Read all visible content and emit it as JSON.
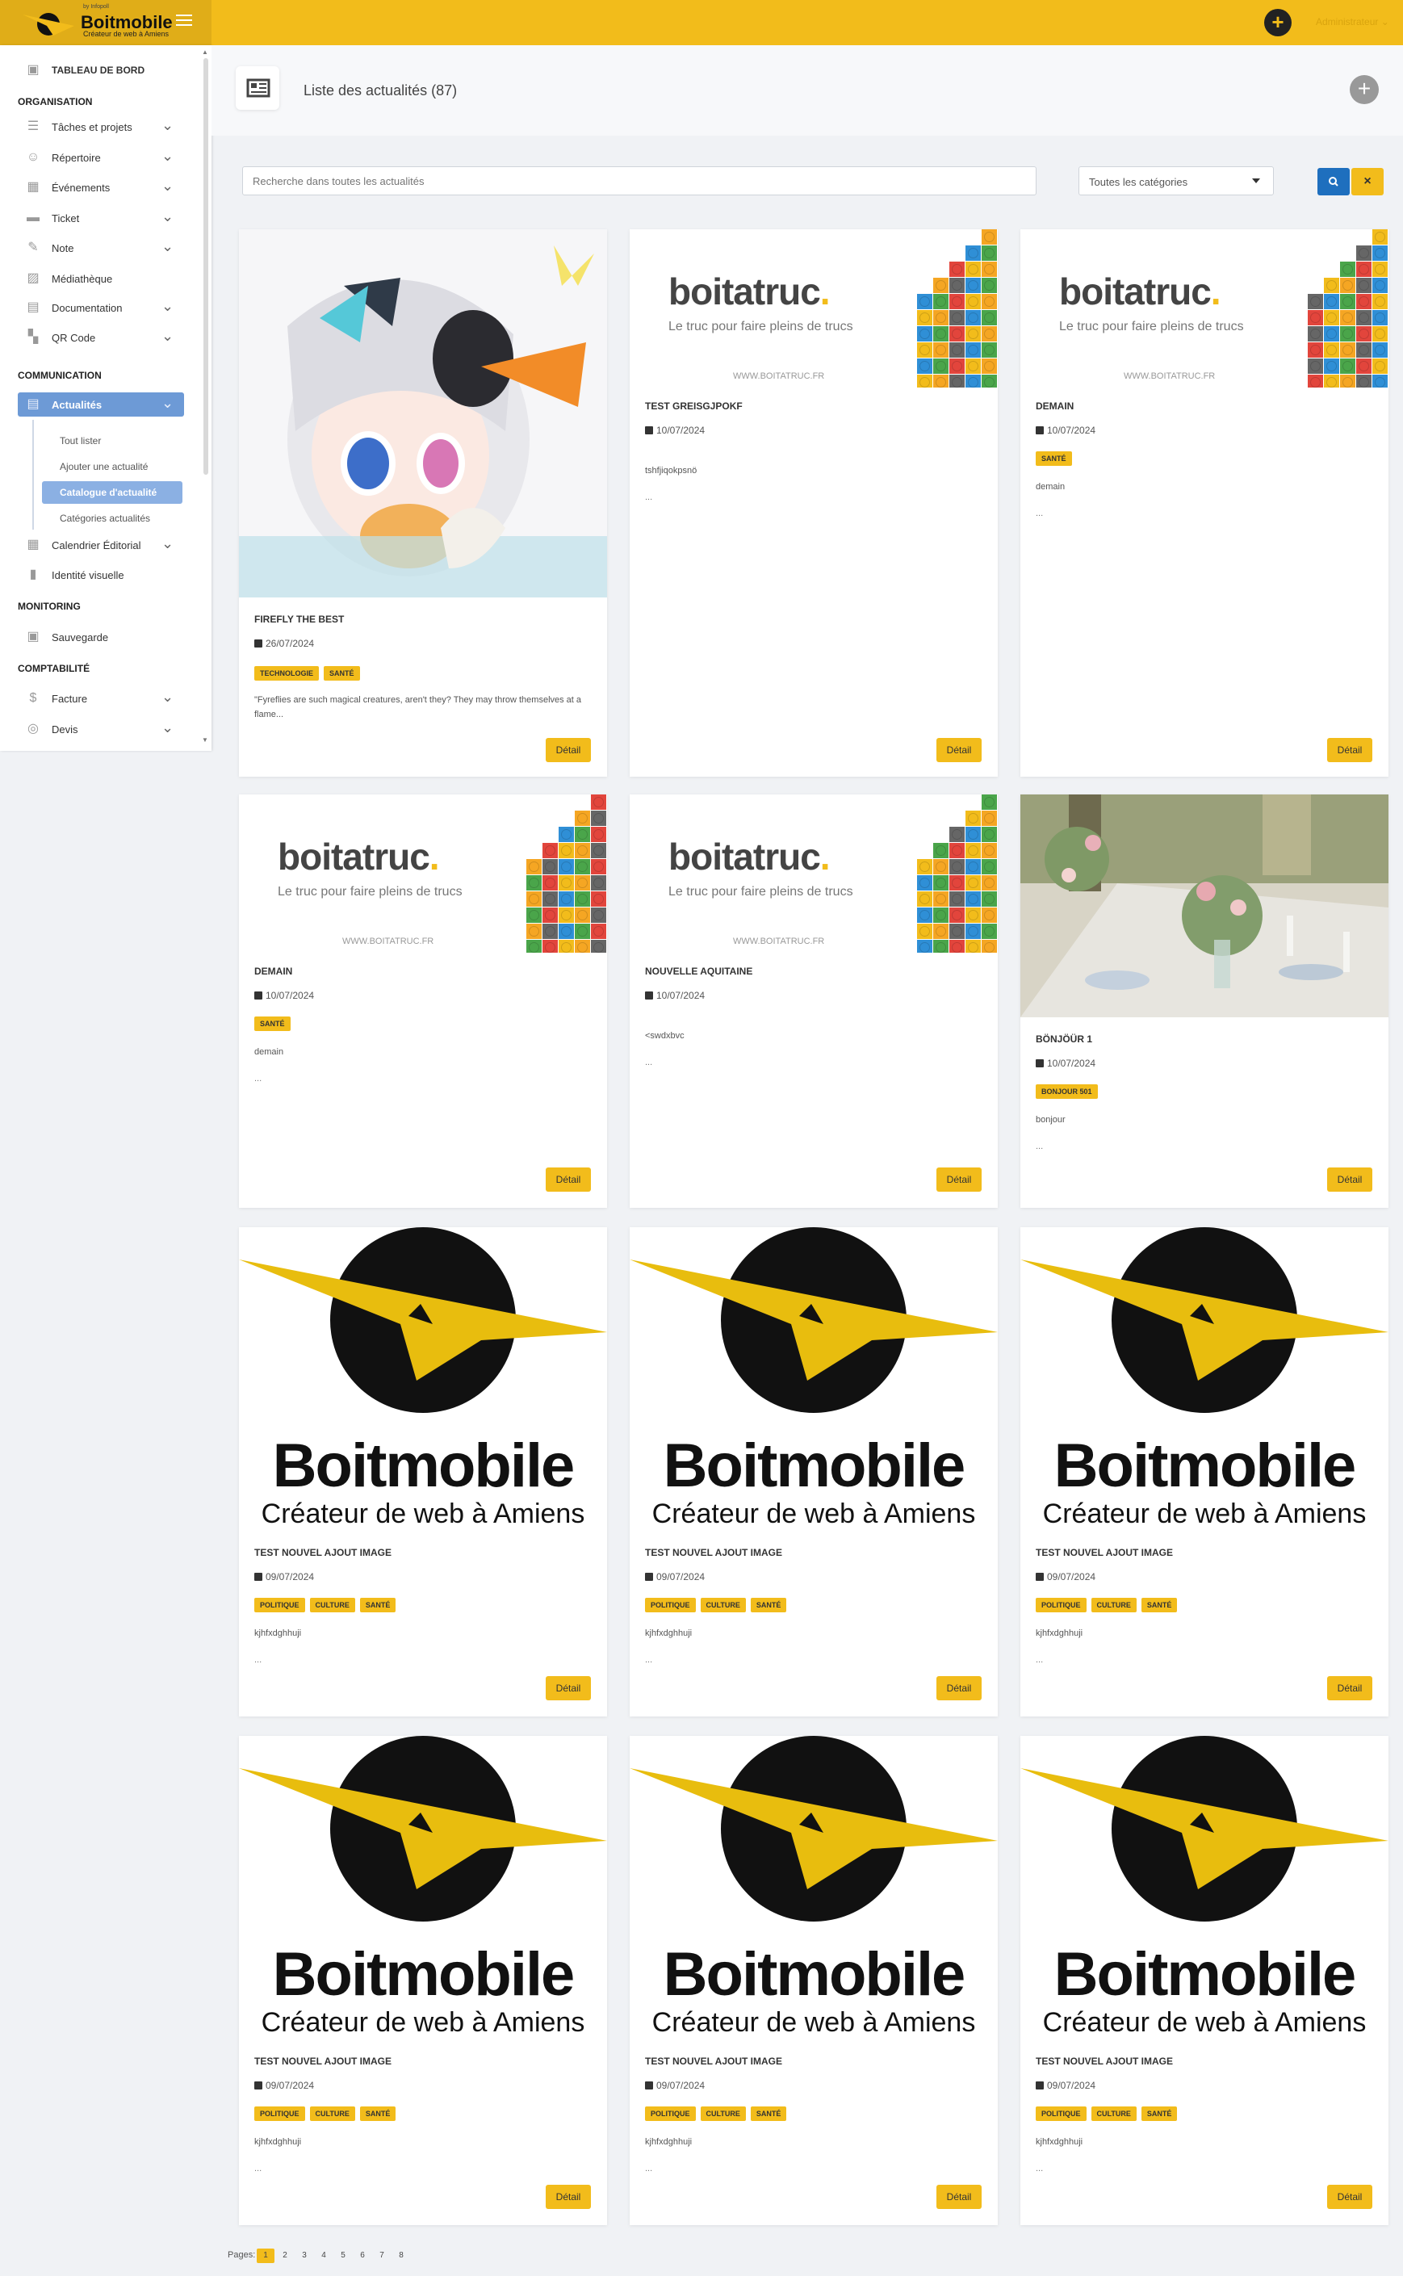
{
  "app": {
    "brand_name": "Boitmobile",
    "brand_tagline": "Créateur de web à Amiens",
    "brand_overline": "by Infopoll",
    "user_label": "Administrateur"
  },
  "sidebar": {
    "dashboard": "TABLEAU DE BORD",
    "sections": {
      "organisation": "ORGANISATION",
      "communication": "COMMUNICATION",
      "monitoring": "MONITORING",
      "comptabilite": "COMPTABILITÉ"
    },
    "items": {
      "taches": "Tâches et projets",
      "repertoire": "Répertoire",
      "evenements": "Événements",
      "ticket": "Ticket",
      "note": "Note",
      "mediatheque": "Médiathèque",
      "documentation": "Documentation",
      "qrcode": "QR Code",
      "actualites": "Actualités",
      "calendrier": "Calendrier Éditorial",
      "identite": "Identité visuelle",
      "sauvegarde": "Sauvegarde",
      "facture": "Facture",
      "devis": "Devis"
    },
    "subitems": {
      "tout_lister": "Tout lister",
      "ajouter": "Ajouter une actualité",
      "catalogue": "Catalogue d'actualité",
      "categories": "Catégories actualités"
    }
  },
  "page": {
    "title": "Liste des actualités (87)"
  },
  "filters": {
    "search_placeholder": "Recherche dans toutes les actualités",
    "category_selected": "Toutes les catégories",
    "clear_label": "×"
  },
  "detail_label": "Détail",
  "boitatruc": {
    "name": "boitatruc",
    "dot": ".",
    "tagline": "Le truc pour faire pleins de trucs",
    "url": "WWW.BOITATRUC.FR"
  },
  "cards": [
    {
      "title": "FIREFLY THE BEST",
      "date": "26/07/2024",
      "tags": [
        "TECHNOLOGIE",
        "SANTÉ"
      ],
      "excerpt": "\"Fyreflies are such magical creatures, aren't they? They may throw themselves at a flame...",
      "dots": ""
    },
    {
      "title": "TEST GREISGJPOKF",
      "date": "10/07/2024",
      "tags": [],
      "excerpt": "tshfjiqokpsnö",
      "dots": "..."
    },
    {
      "title": "DEMAIN",
      "date": "10/07/2024",
      "tags": [
        "SANTÉ"
      ],
      "excerpt": "demain",
      "dots": "..."
    },
    {
      "title": "DEMAIN",
      "date": "10/07/2024",
      "tags": [
        "SANTÉ"
      ],
      "excerpt": "demain",
      "dots": "..."
    },
    {
      "title": "NOUVELLE AQUITAINE",
      "date": "10/07/2024",
      "tags": [],
      "excerpt": "<swdxbvc",
      "dots": "..."
    },
    {
      "title": "BÖNJÖÜR 1",
      "date": "10/07/2024",
      "tags": [
        "BONJOUR 501"
      ],
      "excerpt": "bonjour",
      "dots": "..."
    },
    {
      "title": "TEST NOUVEL AJOUT IMAGE",
      "date": "09/07/2024",
      "tags": [
        "POLITIQUE",
        "CULTURE",
        "SANTÉ"
      ],
      "excerpt": "kjhfxdghhuji",
      "dots": "..."
    },
    {
      "title": "TEST NOUVEL AJOUT IMAGE",
      "date": "09/07/2024",
      "tags": [
        "POLITIQUE",
        "CULTURE",
        "SANTÉ"
      ],
      "excerpt": "kjhfxdghhuji",
      "dots": "..."
    },
    {
      "title": "TEST NOUVEL AJOUT IMAGE",
      "date": "09/07/2024",
      "tags": [
        "POLITIQUE",
        "CULTURE",
        "SANTÉ"
      ],
      "excerpt": "kjhfxdghhuji",
      "dots": "..."
    },
    {
      "title": "TEST NOUVEL AJOUT IMAGE",
      "date": "09/07/2024",
      "tags": [
        "POLITIQUE",
        "CULTURE",
        "SANTÉ"
      ],
      "excerpt": "kjhfxdghhuji",
      "dots": "..."
    },
    {
      "title": "TEST NOUVEL AJOUT IMAGE",
      "date": "09/07/2024",
      "tags": [
        "POLITIQUE",
        "CULTURE",
        "SANTÉ"
      ],
      "excerpt": "kjhfxdghhuji",
      "dots": "..."
    },
    {
      "title": "TEST NOUVEL AJOUT IMAGE",
      "date": "09/07/2024",
      "tags": [
        "POLITIQUE",
        "CULTURE",
        "SANTÉ"
      ],
      "excerpt": "kjhfxdghhuji",
      "dots": "..."
    }
  ],
  "pagination": {
    "label": "Pages:",
    "pages": [
      "1",
      "2",
      "3",
      "4",
      "5",
      "6",
      "7",
      "8"
    ],
    "current": "1"
  },
  "colors": {
    "accent": "#f2bc1b",
    "sidebar_active": "#6d9ad6",
    "search_button": "#1e6fbe"
  }
}
